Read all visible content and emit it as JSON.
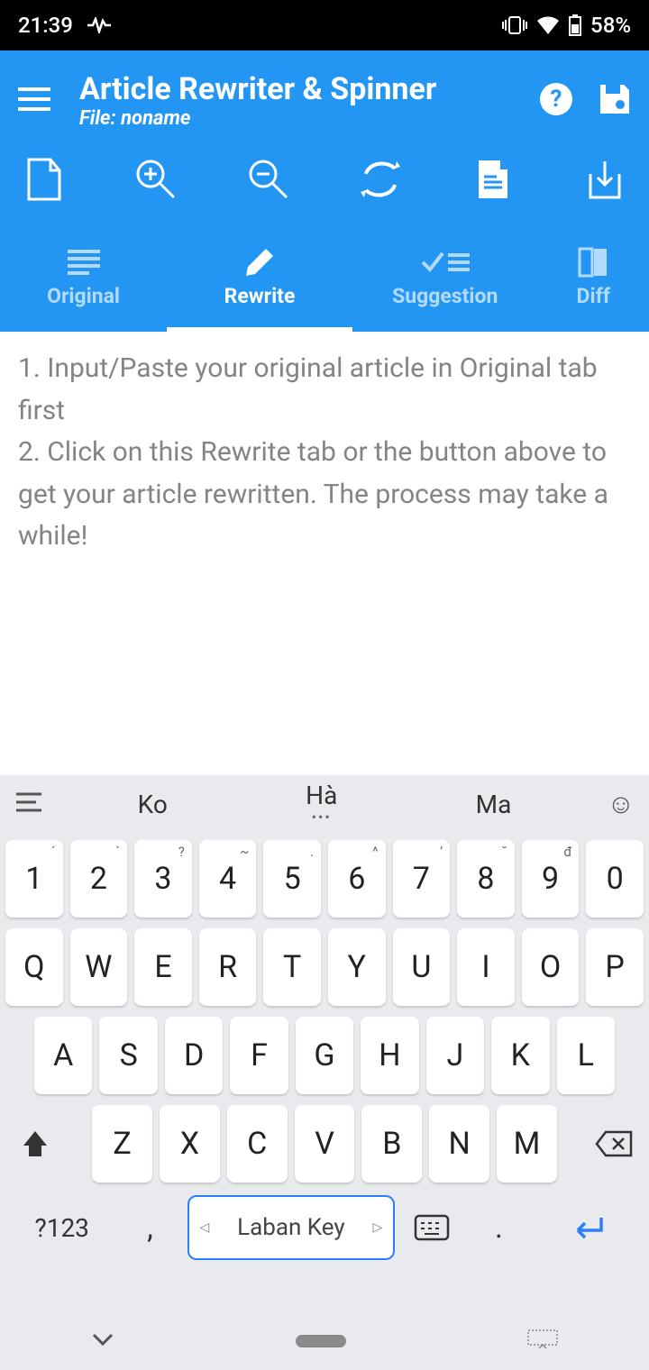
{
  "status": {
    "time": "21:39",
    "battery": "58%"
  },
  "header": {
    "title": "Article Rewriter & Spinner",
    "file_label": "File: noname"
  },
  "tabs": {
    "original": "Original",
    "rewrite": "Rewrite",
    "suggestion": "Suggestion",
    "diff": "Diff"
  },
  "content": {
    "text": "1. Input/Paste your original article in Original tab first\n2. Click on this Rewrite tab or the button above to get your article rewritten. The process may take a while!"
  },
  "keyboard": {
    "suggestions": [
      "Ko",
      "Hà",
      "Ma"
    ],
    "row1": [
      "1",
      "2",
      "3",
      "4",
      "5",
      "6",
      "7",
      "8",
      "9",
      "0"
    ],
    "hints1": [
      "´",
      "`",
      "?",
      "~",
      ".",
      "^",
      "’",
      "˘",
      "đ",
      ""
    ],
    "row2": [
      "Q",
      "W",
      "E",
      "R",
      "T",
      "Y",
      "U",
      "I",
      "O",
      "P"
    ],
    "row3": [
      "A",
      "S",
      "D",
      "F",
      "G",
      "H",
      "J",
      "K",
      "L"
    ],
    "row4": [
      "Z",
      "X",
      "C",
      "V",
      "B",
      "N",
      "M"
    ],
    "mode_key": "?123",
    "space_label": "Laban Key",
    "comma": ",",
    "period": "."
  }
}
